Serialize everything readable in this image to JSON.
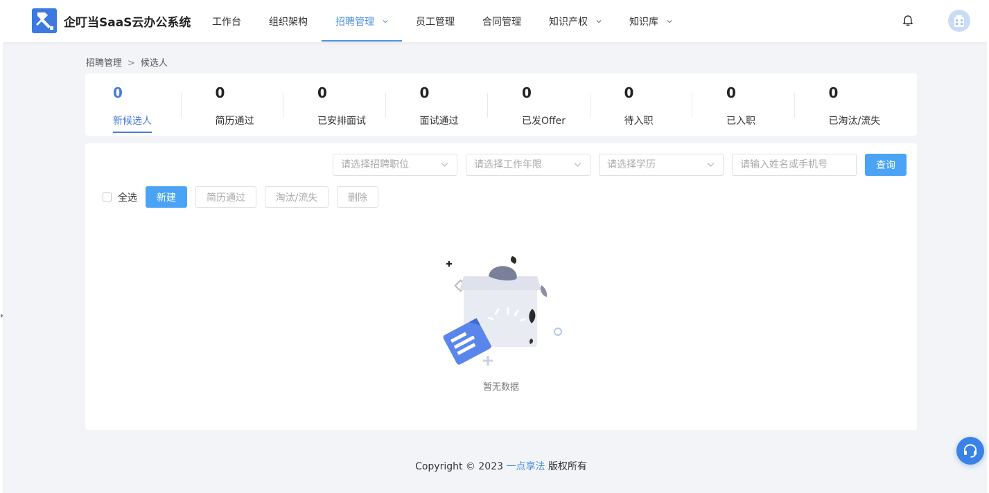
{
  "header": {
    "brand": "企叮当SaaS云办公系统",
    "nav": [
      {
        "label": "工作台",
        "dropdown": false,
        "active": false
      },
      {
        "label": "组织架构",
        "dropdown": false,
        "active": false
      },
      {
        "label": "招聘管理",
        "dropdown": true,
        "active": true
      },
      {
        "label": "员工管理",
        "dropdown": false,
        "active": false
      },
      {
        "label": "合同管理",
        "dropdown": false,
        "active": false
      },
      {
        "label": "知识产权",
        "dropdown": true,
        "active": false
      },
      {
        "label": "知识库",
        "dropdown": true,
        "active": false
      }
    ],
    "icons": {
      "logo": "hammer-logo-icon",
      "notification": "bell-icon",
      "avatar": "building-avatar"
    }
  },
  "breadcrumb": {
    "parent": "招聘管理",
    "separator": ">",
    "current": "候选人"
  },
  "stats": [
    {
      "value": "0",
      "label": "新候选人",
      "active": true
    },
    {
      "value": "0",
      "label": "简历通过",
      "active": false
    },
    {
      "value": "0",
      "label": "已安排面试",
      "active": false
    },
    {
      "value": "0",
      "label": "面试通过",
      "active": false
    },
    {
      "value": "0",
      "label": "已发Offer",
      "active": false
    },
    {
      "value": "0",
      "label": "待入职",
      "active": false
    },
    {
      "value": "0",
      "label": "已入职",
      "active": false
    },
    {
      "value": "0",
      "label": "已淘汰/流失",
      "active": false
    }
  ],
  "filters": {
    "position_placeholder": "请选择招聘职位",
    "experience_placeholder": "请选择工作年限",
    "education_placeholder": "请选择学历",
    "search_placeholder": "请输入姓名或手机号",
    "search_button": "查询"
  },
  "toolbar": {
    "select_all": "全选",
    "new": "新建",
    "resume_pass": "简历通过",
    "eliminate": "淘汰/流失",
    "delete": "删除"
  },
  "empty": {
    "text": "暂无数据"
  },
  "footer": {
    "prefix": "Copyright © 2023",
    "company": "一点享法",
    "suffix": "版权所有"
  },
  "colors": {
    "accent": "#4a90e2",
    "primary_button": "#4aa3f5",
    "active_stat": "#4a7bd8",
    "support": "#3b82e8"
  }
}
